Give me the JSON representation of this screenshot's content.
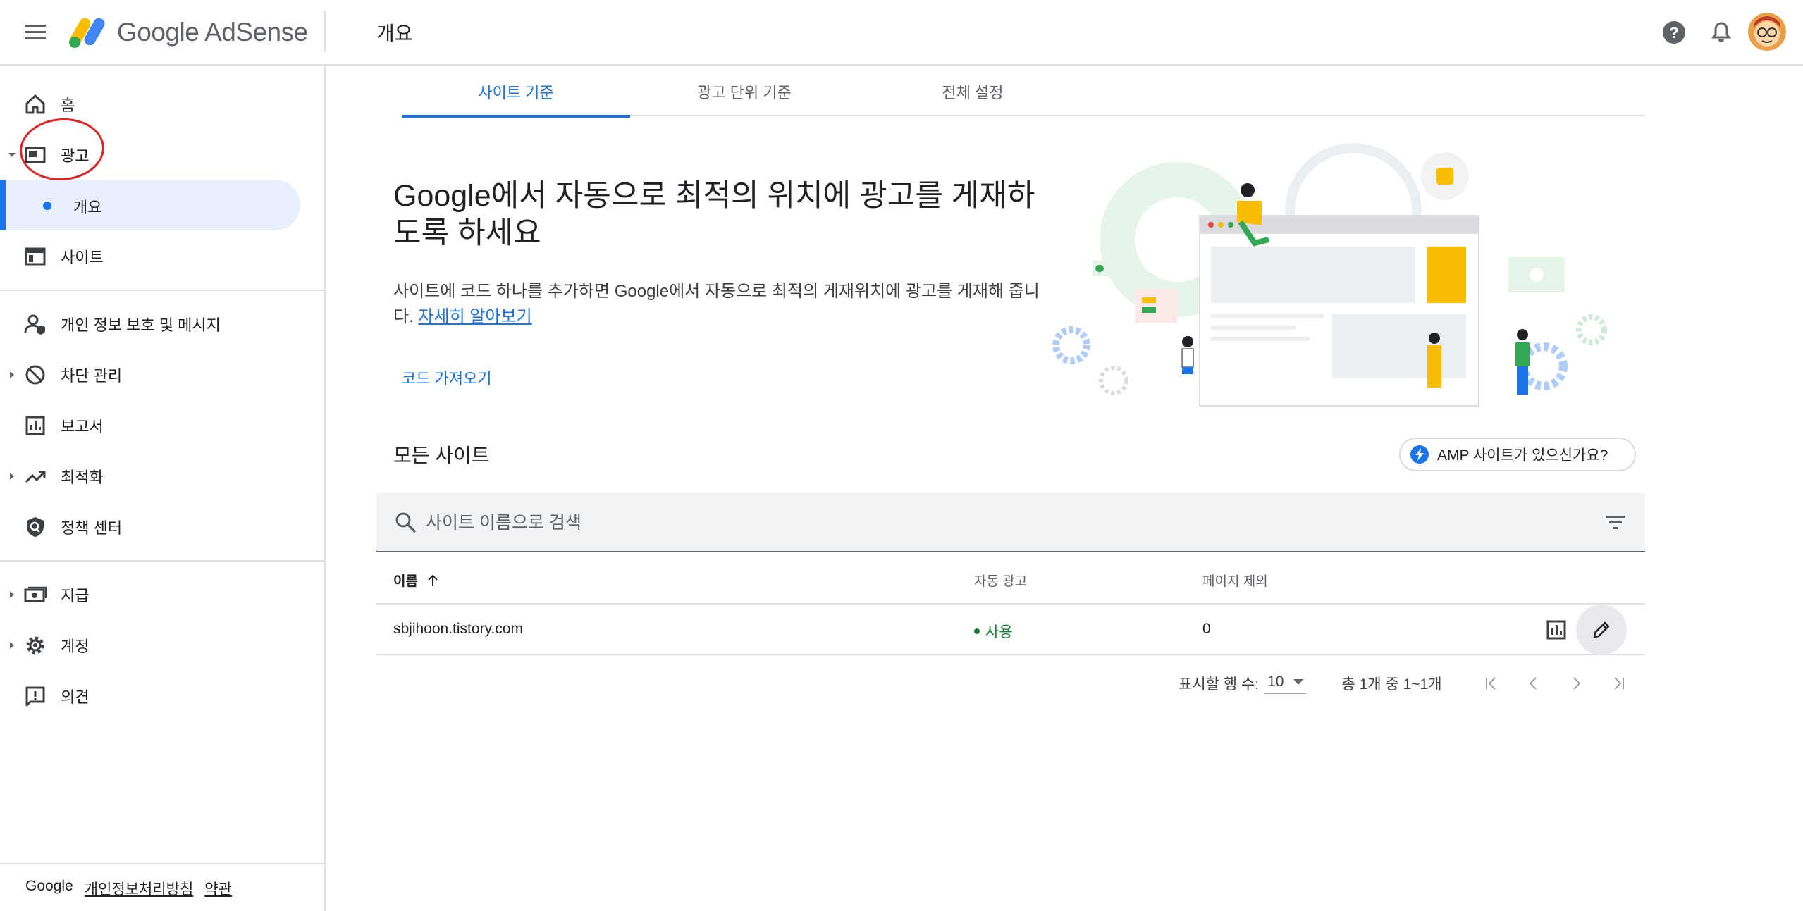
{
  "header": {
    "logo_text": "Google AdSense",
    "page_title": "개요",
    "menu_icon": "hamburger-menu-icon",
    "help_icon": "help-circle-icon",
    "notifications_icon": "bell-icon"
  },
  "sidebar": {
    "items": [
      {
        "label": "홈",
        "icon": "home-icon"
      },
      {
        "label": "광고",
        "icon": "ads-icon"
      },
      {
        "label": "개요",
        "icon": "dot"
      },
      {
        "label": "사이트",
        "icon": "sites-icon"
      },
      {
        "label": "개인 정보 보호 및 메시지",
        "icon": "privacy-icon"
      },
      {
        "label": "차단 관리",
        "icon": "block-icon"
      },
      {
        "label": "보고서",
        "icon": "reports-icon"
      },
      {
        "label": "최적화",
        "icon": "trending-up-icon"
      },
      {
        "label": "정책 센터",
        "icon": "policy-icon"
      },
      {
        "label": "지급",
        "icon": "payments-icon"
      },
      {
        "label": "계정",
        "icon": "gear-icon"
      },
      {
        "label": "의견",
        "icon": "feedback-icon"
      }
    ],
    "footer": {
      "brand": "Google",
      "privacy": "개인정보처리방침",
      "terms": "약관"
    }
  },
  "tabs": [
    {
      "label": "사이트 기준"
    },
    {
      "label": "광고 단위 기준"
    },
    {
      "label": "전체 설정"
    }
  ],
  "hero": {
    "title": "Google에서 자동으로 최적의 위치에 광고를 게재하도록 하세요",
    "description": "사이트에 코드 하나를 추가하면 Google에서 자동으로 최적의 게재위치에 광고를 게재해 줍니다.",
    "learn_more": "자세히 알아보기",
    "get_code": "코드 가져오기"
  },
  "sites": {
    "heading": "모든 사이트",
    "amp_button": "AMP 사이트가 있으신가요?",
    "search_placeholder": "사이트 이름으로 검색",
    "columns": {
      "name": "이름",
      "auto_ads": "자동 광고",
      "page_exclusions": "페이지 제외"
    },
    "rows": [
      {
        "name": "sbjihoon.tistory.com",
        "auto_ads": "사용",
        "page_exclusions": "0"
      }
    ]
  },
  "pagination": {
    "rows_label": "표시할 행 수:",
    "rows_value": "10",
    "range": "총 1개 중 1~1개"
  },
  "colors": {
    "accent": "#1a73e8",
    "status_on": "#188038",
    "annotation": "#e02424"
  }
}
